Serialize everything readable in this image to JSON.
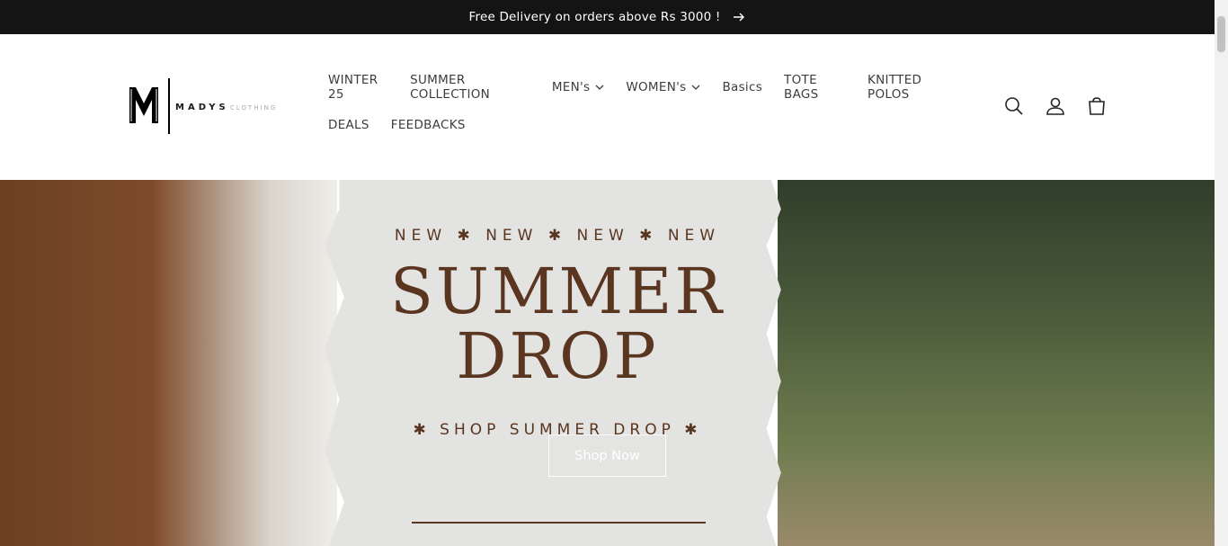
{
  "announcement": {
    "text": "Free Delivery on orders above Rs 3000 !",
    "icon": "arrow-right-icon"
  },
  "brand": {
    "mark": "M",
    "name": "MADYS",
    "tagline": "CLOTHING"
  },
  "nav": {
    "row1": [
      {
        "label": "WINTER 25",
        "dropdown": false
      },
      {
        "label": "SUMMER COLLECTION",
        "dropdown": false
      },
      {
        "label": "MEN's",
        "dropdown": true
      },
      {
        "label": "WOMEN's",
        "dropdown": true
      },
      {
        "label": "Basics",
        "dropdown": false
      },
      {
        "label": "TOTE BAGS",
        "dropdown": false
      },
      {
        "label": "KNITTED POLOS",
        "dropdown": false
      }
    ],
    "row2": [
      {
        "label": "DEALS",
        "dropdown": false
      },
      {
        "label": "FEEDBACKS",
        "dropdown": false
      }
    ]
  },
  "icons": {
    "search": "search-icon",
    "account": "account-icon",
    "cart": "cart-icon"
  },
  "hero": {
    "kicker": "NEW ✱ NEW ✱ NEW ✱ NEW",
    "headline_line1": "SUMMER",
    "headline_line2": "DROP",
    "sub": "✱ SHOP SUMMER DROP ✱",
    "button_label": "Shop Now",
    "colors": {
      "text": "#5a3520",
      "paper": "#e3e3e1"
    }
  }
}
